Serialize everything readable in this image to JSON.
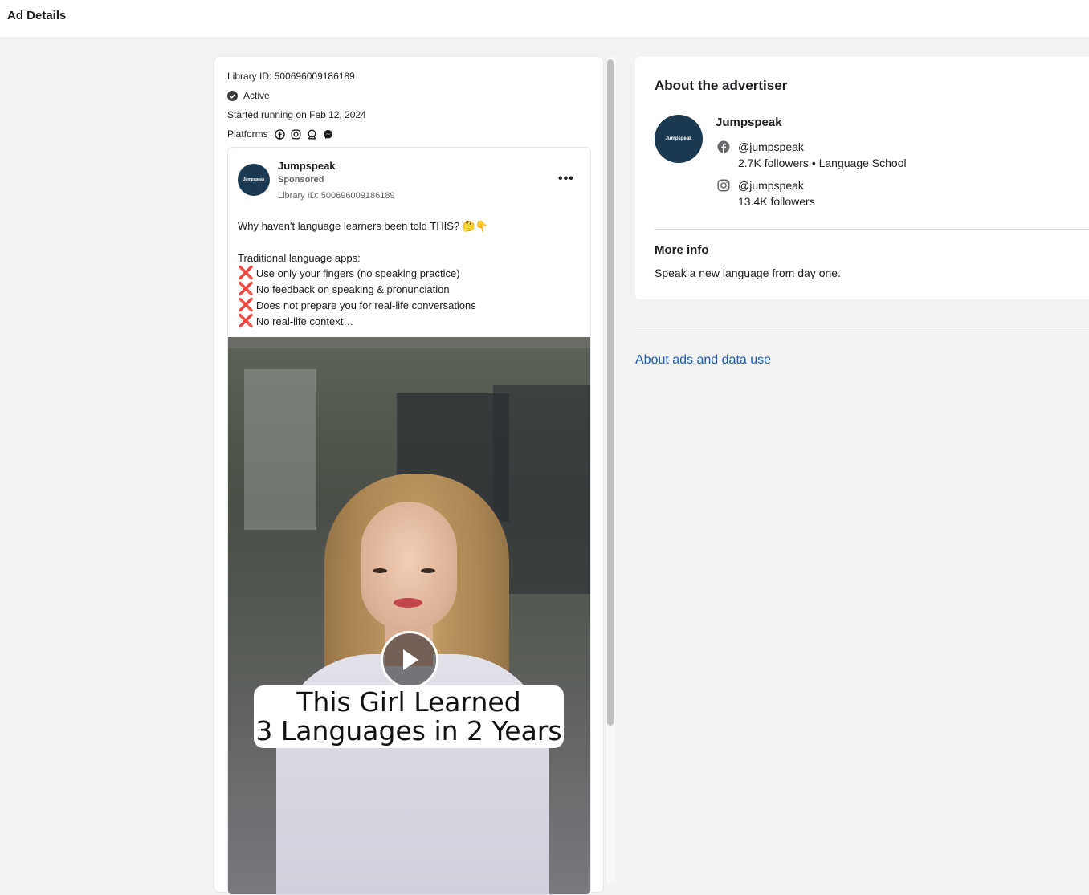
{
  "header": {
    "title": "Ad Details"
  },
  "ad_meta": {
    "library_id": "Library ID: 500696009186189",
    "status": "Active",
    "started": "Started running on Feb 12, 2024",
    "platforms_label": "Platforms",
    "platform_icons": [
      "facebook-icon",
      "instagram-icon",
      "audience-network-icon",
      "messenger-icon"
    ]
  },
  "ad_preview": {
    "advertiser": "Jumpspeak",
    "avatar_text": "Jumpspeak",
    "sponsored": "Sponsored",
    "library_id": "Library ID: 500696009186189",
    "more": "•••",
    "headline": "Why haven't language learners been told THIS? 🤔👇",
    "list_intro": "Traditional language apps:",
    "list_items": [
      "Use only your fingers (no speaking practice)",
      "No feedback on speaking & pronunciation",
      "Does not prepare you for real-life conversations",
      "No real-life context…"
    ],
    "x_mark": "❌",
    "video_caption_line1": "This Girl Learned",
    "video_caption_line2": "3 Languages in 2 Years"
  },
  "advertiser_panel": {
    "title": "About the advertiser",
    "name": "Jumpspeak",
    "avatar_text": "Jumpspeak",
    "facebook_handle": "@jumpspeak",
    "facebook_stats": "2.7K followers • Language School",
    "instagram_handle": "@jumpspeak",
    "instagram_stats": "13.4K followers",
    "more_info_title": "More info",
    "more_info_text": "Speak a new language from day one."
  },
  "footer": {
    "about_link": "About ads and data use"
  },
  "colors": {
    "avatar_bg": "#1b3a52",
    "link": "#1a5fb4",
    "x_mark": "#e53935"
  }
}
